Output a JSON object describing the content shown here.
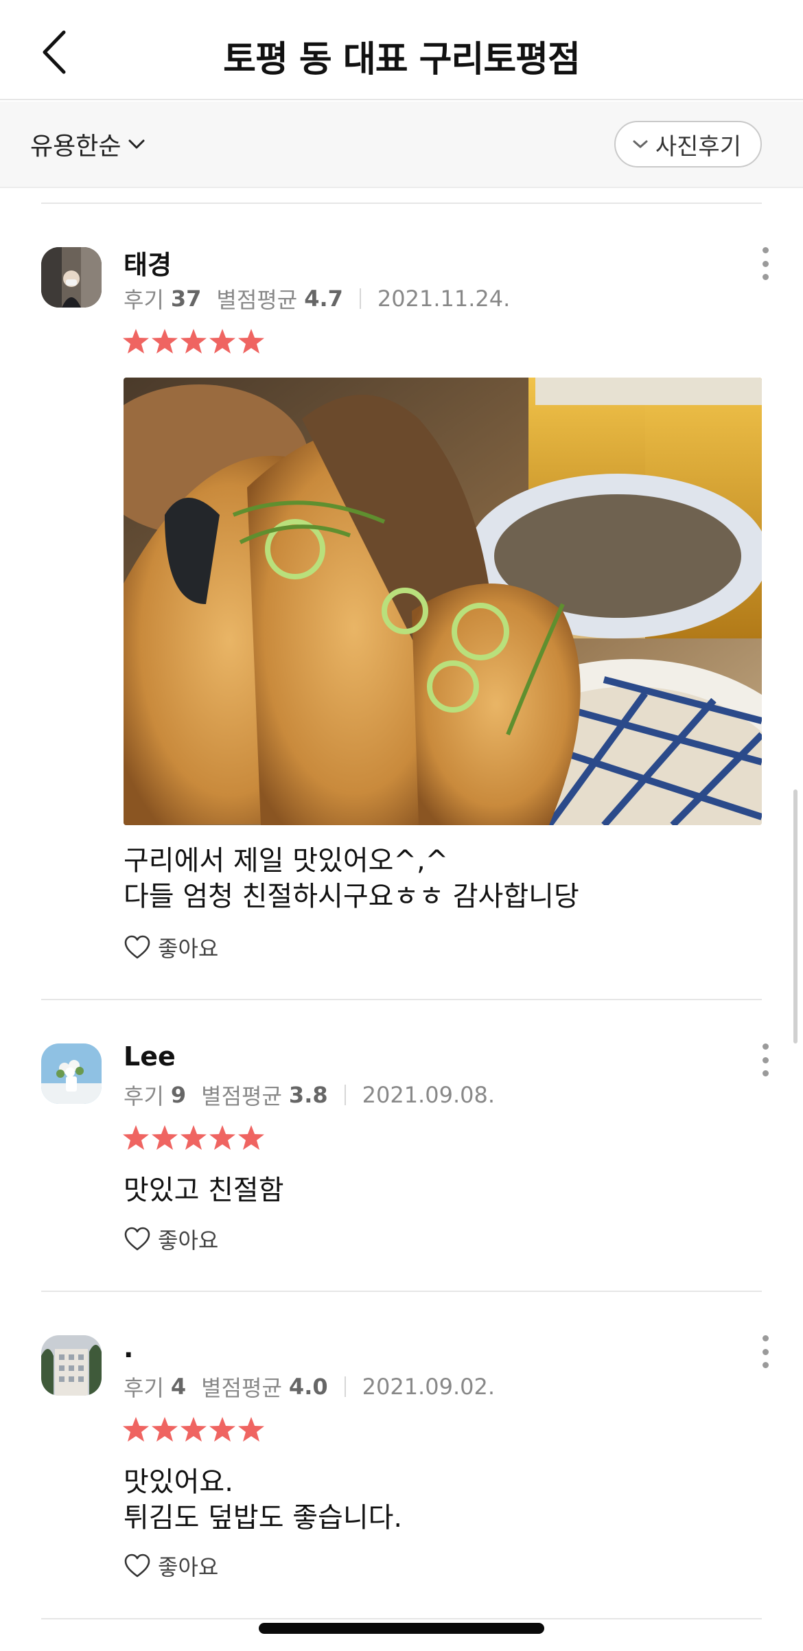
{
  "header": {
    "title": "토평 동 대표 구리토평점"
  },
  "filter": {
    "sort_label": "유용한순",
    "photo_filter_label": "사진후기"
  },
  "reviews": [
    {
      "nickname": "태경",
      "review_count_label": "후기",
      "review_count": "37",
      "avg_rating_label": "별점평균",
      "avg_rating": "4.7",
      "date": "2021.11.24.",
      "stars": 5,
      "text": "구리에서 제일 맛있어오^,^\n다들 엄청 친절하시구요ㅎㅎ 감사합니당",
      "like_label": "좋아요"
    },
    {
      "nickname": "Lee",
      "review_count_label": "후기",
      "review_count": "9",
      "avg_rating_label": "별점평균",
      "avg_rating": "3.8",
      "date": "2021.09.08.",
      "stars": 5,
      "text": "맛있고 친절함",
      "like_label": "좋아요"
    },
    {
      "nickname": ".",
      "review_count_label": "후기",
      "review_count": "4",
      "avg_rating_label": "별점평균",
      "avg_rating": "4.0",
      "date": "2021.09.02.",
      "stars": 5,
      "text": "맛있어요.\n튀김도 덮밥도 좋습니다.",
      "like_label": "좋아요"
    }
  ],
  "colors": {
    "star": "#ef6461",
    "accent_text": "#111111",
    "muted_text": "#888888"
  }
}
